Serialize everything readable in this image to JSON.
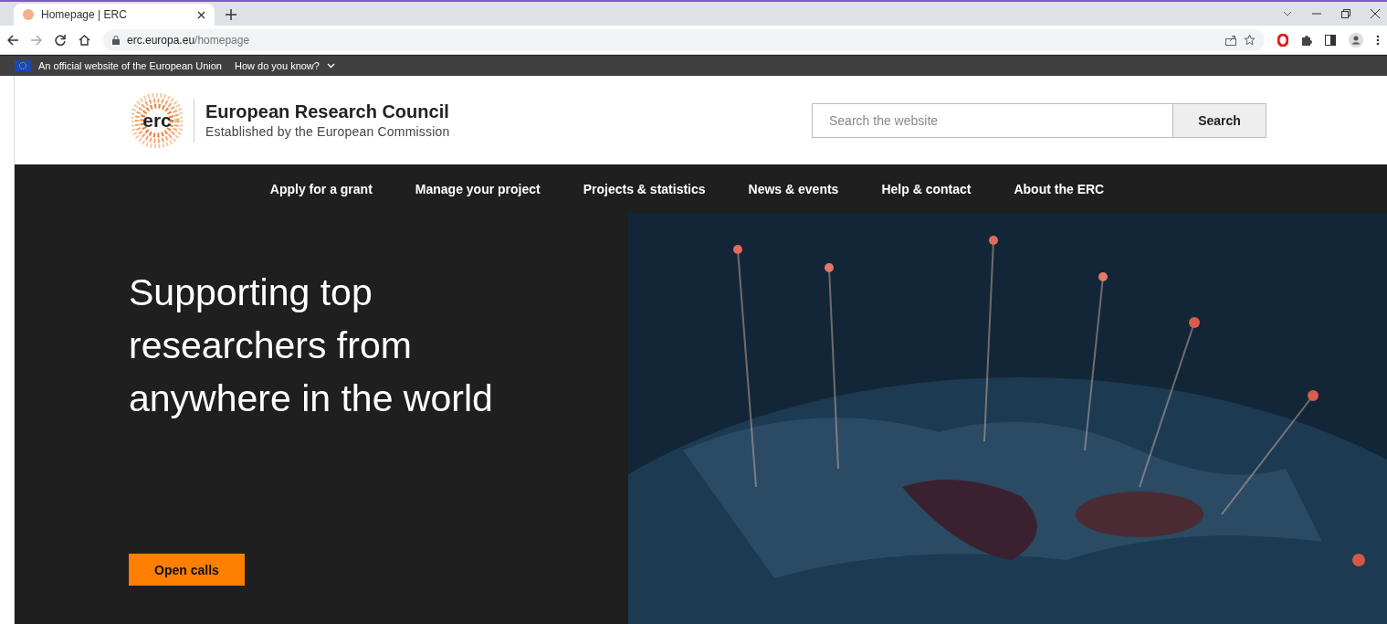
{
  "browser": {
    "tab": {
      "title": "Homepage | ERC",
      "selected": true
    },
    "url_host": "erc.europa.eu",
    "url_path": "/homepage"
  },
  "eu_banner": {
    "text": "An official website of the European Union",
    "link": "How do you know?"
  },
  "header": {
    "logo_text": "erc",
    "title": "European Research Council",
    "subtitle": "Established by the European Commission",
    "search": {
      "placeholder": "Search the website",
      "button": "Search"
    }
  },
  "nav": [
    {
      "label": "Apply for a grant"
    },
    {
      "label": "Manage your project"
    },
    {
      "label": "Projects & statistics"
    },
    {
      "label": "News & events"
    },
    {
      "label": "Help & contact"
    },
    {
      "label": "About the ERC"
    }
  ],
  "hero": {
    "heading": "Supporting top researchers from anywhere in the world",
    "button": "Open calls"
  }
}
